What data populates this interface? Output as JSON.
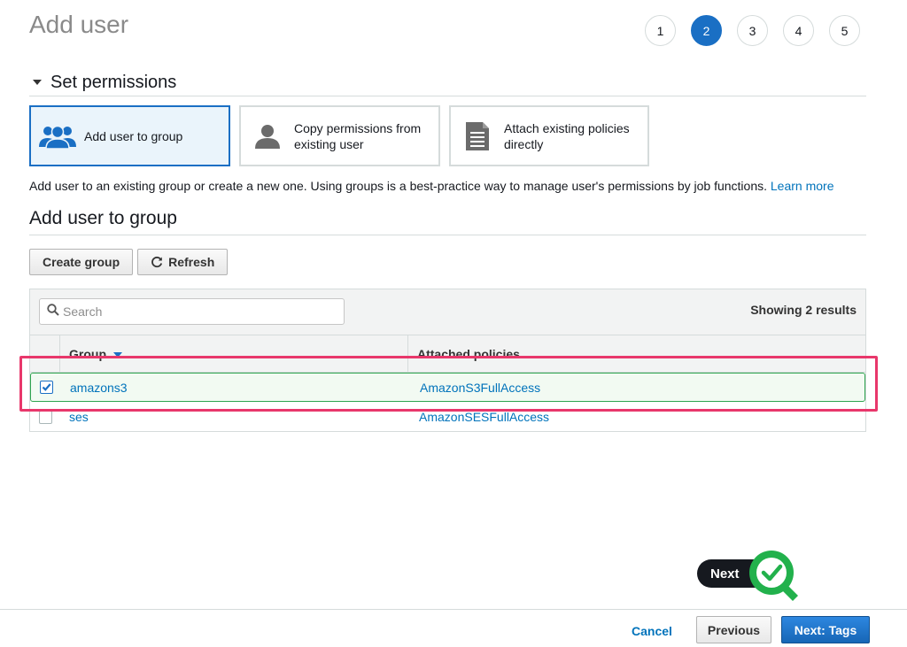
{
  "page": {
    "title": "Add user"
  },
  "steps": [
    "1",
    "2",
    "3",
    "4",
    "5"
  ],
  "active_step": "2",
  "permissions": {
    "heading": "Set permissions",
    "options": [
      {
        "line1": "Add user to group",
        "line2": "",
        "icon": "group-icon",
        "selected": true
      },
      {
        "line1": "Copy permissions from",
        "line2": "existing user",
        "icon": "user-icon",
        "selected": false
      },
      {
        "line1": "Attach existing policies",
        "line2": "directly",
        "icon": "document-icon",
        "selected": false
      }
    ],
    "description": "Add user to an existing group or create a new one. Using groups is a best-practice way to manage user's permissions by job functions.",
    "learn_more": "Learn more"
  },
  "group_section": {
    "heading": "Add user to group",
    "create_label": "Create group",
    "refresh_label": "Refresh",
    "search_placeholder": "Search",
    "results_text": "Showing 2 results",
    "columns": {
      "group": "Group",
      "policies": "Attached policies"
    },
    "rows": [
      {
        "group": "amazons3",
        "policy": "AmazonS3FullAccess",
        "checked": true
      },
      {
        "group": "ses",
        "policy": "AmazonSESFullAccess",
        "checked": false
      }
    ]
  },
  "hint": {
    "label": "Next"
  },
  "footer": {
    "cancel": "Cancel",
    "previous": "Previous",
    "next": "Next: Tags"
  },
  "colors": {
    "accent": "#1a6fc4",
    "highlight": "#e8376b",
    "success": "#2ea44f"
  }
}
